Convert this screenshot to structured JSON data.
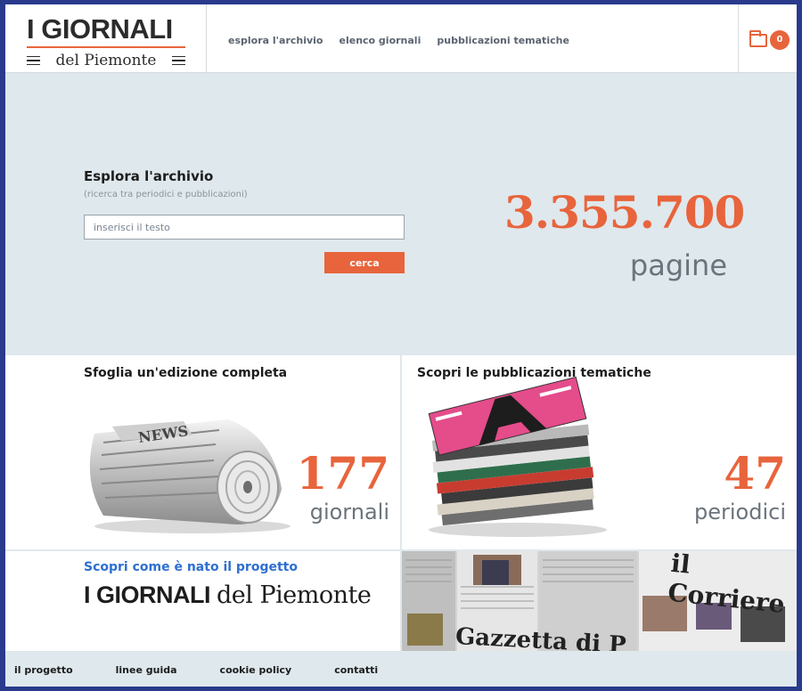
{
  "header": {
    "logo_title": "I GIORNALI",
    "logo_sub": "del Piemonte",
    "nav": [
      "esplora l'archivio",
      "elenco giornali",
      "pubblicazioni tematiche"
    ],
    "cart_count": "0"
  },
  "hero": {
    "title": "Esplora l'archivio",
    "subtitle": "(ricerca tra periodici e pubblicazioni)",
    "search_placeholder": "inserisci il testo",
    "search_button": "cerca",
    "count": "3.355.700",
    "count_unit": "pagine"
  },
  "panels": [
    {
      "title": "Sfoglia un'edizione completa",
      "count": "177",
      "unit": "giornali"
    },
    {
      "title": "Scopri le pubblicazioni tematiche",
      "count": "47",
      "unit": "periodici"
    }
  ],
  "project": {
    "kicker": "Scopri come è nato il progetto",
    "name_bold": "I GIORNALI",
    "name_serif": "del Piemonte"
  },
  "collage": {
    "headline_1": "il Corriere",
    "headline_2": "Gazzetta di P"
  },
  "footer": [
    "il progetto",
    "linee guida",
    "cookie policy",
    "contatti"
  ],
  "colors": {
    "accent": "#e8643c",
    "link_blue": "#2e6fd0",
    "hero_bg": "#dfe8ec"
  }
}
